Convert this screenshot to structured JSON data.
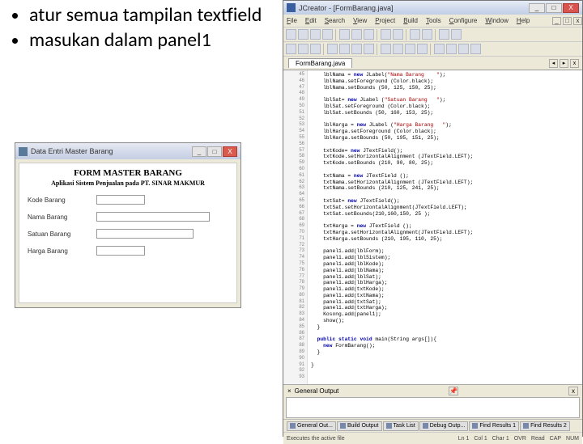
{
  "bullets": [
    "atur semua tampilan textfield",
    "masukan dalam panel1"
  ],
  "formwin": {
    "title": "Data Entri Master Barang",
    "header": "FORM MASTER BARANG",
    "sub": "Aplikasi Sistem Penjualan pada PT. SINAR MAKMUR",
    "labels": [
      "Kode Barang",
      "Nama Barang",
      "Satuan Barang",
      "Harga Barang"
    ]
  },
  "ide": {
    "title": "JCreator - [FormBarang.java]",
    "menu": [
      "File",
      "Edit",
      "Search",
      "View",
      "Project",
      "Build",
      "Tools",
      "Configure",
      "Window",
      "Help"
    ],
    "tab": "FormBarang.java",
    "gutter_start": 45,
    "gutter_end": 93,
    "code_lines": [
      "    lblNama = new JLabel(\"Nama Barang    \");",
      "    lblNama.setForeground (Color.black);",
      "    lblNama.setBounds (50, 125, 150, 25);",
      "",
      "    lblSat= new JLabel (\"Satuan Barang   \");",
      "    lblSat.setForeground (Color.black);",
      "    lblSat.setBounds (50, 160, 153, 25);",
      "",
      "    lblHarga = new JLabel (\"Harga Barang   \");",
      "    lblHarga.setForeground (Color.black);",
      "    lblHarga.setBounds (50, 195, 151, 25);",
      "",
      "    txtKode= new JTextField();",
      "    txtKode.setHorizontalAlignment (JTextField.LEFT);",
      "    txtKode.setBounds (210, 90, 80, 25);",
      "",
      "    txtNama = new JTextField ();",
      "    txtNama.setHorizontalAlignment (JTextField.LEFT);",
      "    txtNama.setBounds (210, 125, 241, 25);",
      "",
      "    txtSat= new JTextField();",
      "    txtSat.setHorizontalAlignment(JTextField.LEFT);",
      "    txtSat.setBounds(210,160,150, 25 );",
      "",
      "    txtHarga = new JTextField ();",
      "    txtHarga.setHorizontalAlignment(JTextField.LEFT);",
      "    txtHarga.setBounds (210, 195, 110, 25);",
      "",
      "    panel1.add(lblForm);",
      "    panel1.add(lblSistem);",
      "    panel1.add(lblKode);",
      "    panel1.add(lblNama);",
      "    panel1.add(lblSat);",
      "    panel1.add(lblHarga);",
      "    panel1.add(txtKode);",
      "    panel1.add(txtNama);",
      "    panel1.add(txtSat);",
      "    panel1.add(txtHarga);",
      "    Kosong.add(panel1);",
      "    show();",
      "  }",
      "",
      "  public static void main(String args[]){",
      "    new FormBarang();",
      "  }",
      "",
      "}",
      ""
    ],
    "general_output": "General Output",
    "bottabs": [
      "General Out...",
      "Build Output",
      "Task List",
      "Debug Outp...",
      "Find Results 1",
      "Find Results 2"
    ],
    "status_left": "Executes the active file",
    "status_right": [
      "Ln 1",
      "Col 1",
      "Char 1",
      "OVR",
      "Read",
      "CAP",
      "NUM"
    ]
  }
}
